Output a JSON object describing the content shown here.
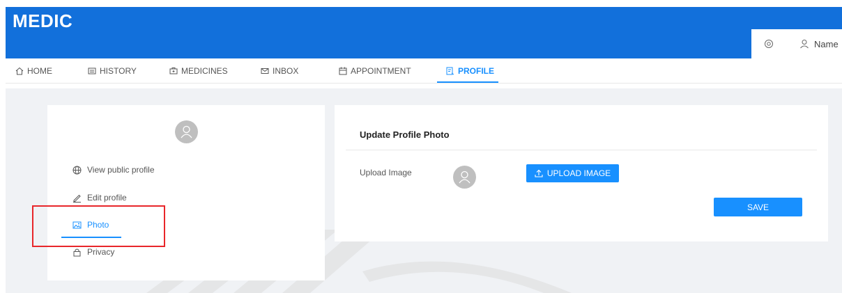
{
  "app": {
    "brand": "MEDIC"
  },
  "header": {
    "user_name": "Name",
    "settings_icon": "gear-icon",
    "user_icon": "user-icon"
  },
  "nav": {
    "items": [
      {
        "label": "HOME",
        "icon": "home-icon"
      },
      {
        "label": "HISTORY",
        "icon": "history-icon"
      },
      {
        "label": "MEDICINES",
        "icon": "medicine-icon"
      },
      {
        "label": "INBOX",
        "icon": "mail-icon"
      },
      {
        "label": "APPOINTMENT",
        "icon": "calendar-icon"
      },
      {
        "label": "PROFILE",
        "icon": "profile-icon",
        "active": true
      }
    ]
  },
  "sidebar": {
    "items": [
      {
        "label": "View public profile",
        "icon": "globe-icon"
      },
      {
        "label": "Edit profile",
        "icon": "edit-icon"
      },
      {
        "label": "Photo",
        "icon": "picture-icon",
        "active": true
      },
      {
        "label": "Privacy",
        "icon": "lock-icon"
      }
    ]
  },
  "main": {
    "title": "Update Profile Photo",
    "upload_label": "Upload Image",
    "upload_button": "UPLOAD IMAGE",
    "save_button": "SAVE"
  },
  "colors": {
    "brand": "#1270db",
    "accent": "#1890ff",
    "highlight_box": "#e8262a"
  }
}
